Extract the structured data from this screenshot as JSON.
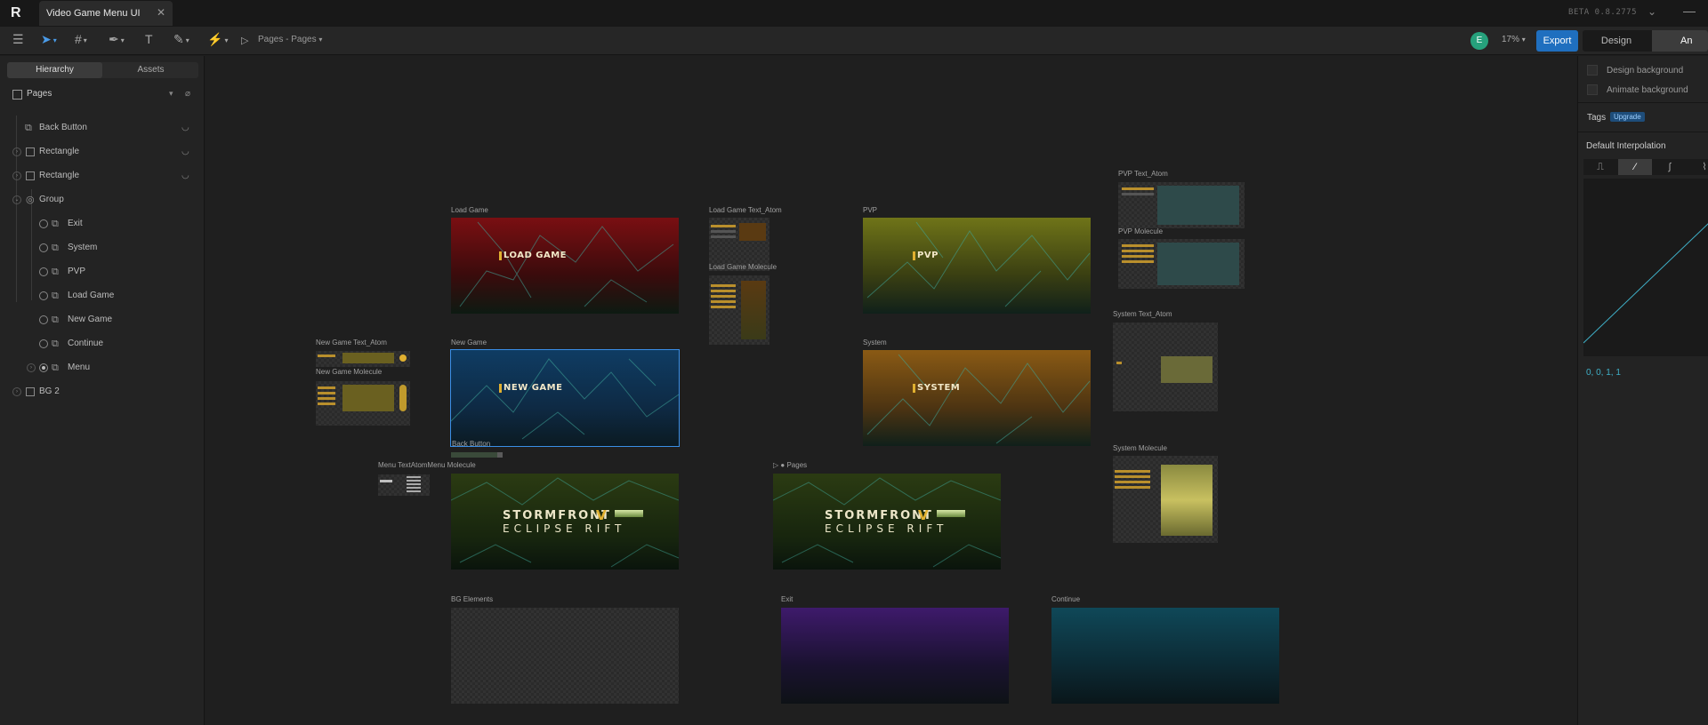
{
  "titlebar": {
    "doc_title": "Video Game Menu UI",
    "close_glyph": "✕",
    "version": "BETA 0.8.2775",
    "chevron": "⌄",
    "minimize_glyph": "—",
    "logo_glyph": "R"
  },
  "toolbar": {
    "breadcrumb": "Pages - Pages",
    "avatar_initial": "E",
    "zoom": "17%",
    "export_label": "Export",
    "mode_design": "Design",
    "mode_animate": "An",
    "icons": [
      "menu-icon",
      "pointer-icon",
      "frame-icon",
      "pen-icon",
      "text-icon",
      "brush-icon",
      "lightning-icon",
      "play-icon"
    ]
  },
  "left_panel": {
    "tab_hierarchy": "Hierarchy",
    "tab_assets": "Assets",
    "pages_label": "Pages",
    "layers": [
      {
        "name": "Back Button",
        "icon": "component-icon"
      },
      {
        "name": "Rectangle",
        "icon": "rectangle-icon"
      },
      {
        "name": "Rectangle",
        "icon": "rectangle-icon"
      },
      {
        "name": "Group",
        "icon": "group-icon"
      },
      {
        "name": "Exit",
        "icon": "component-icon"
      },
      {
        "name": "System",
        "icon": "component-icon"
      },
      {
        "name": "PVP",
        "icon": "component-icon"
      },
      {
        "name": "Load Game",
        "icon": "component-icon"
      },
      {
        "name": "New Game",
        "icon": "component-icon"
      },
      {
        "name": "Continue",
        "icon": "component-icon"
      },
      {
        "name": "Menu",
        "icon": "component-icon"
      },
      {
        "name": "BG 2",
        "icon": "rectangle-icon"
      }
    ]
  },
  "canvas": {
    "frames": {
      "load_game": {
        "label": "Load Game",
        "text": "LOAD GAME"
      },
      "load_game_text_atom": {
        "label": "Load Game Text_Atom"
      },
      "load_game_molecule": {
        "label": "Load Game Molecule"
      },
      "pvp": {
        "label": "PVP",
        "text": "PVP"
      },
      "pvp_text_atom": {
        "label": "PVP Text_Atom"
      },
      "pvp_molecule": {
        "label": "PVP Molecule"
      },
      "new_game_text_atom": {
        "label": "New Game Text_Atom"
      },
      "new_game_molecule": {
        "label": "New Game Molecule"
      },
      "new_game": {
        "label": "New Game",
        "text": "NEW GAME"
      },
      "system": {
        "label": "System",
        "text": "SYSTEM"
      },
      "system_text_atom": {
        "label": "System Text_Atom"
      },
      "system_molecule": {
        "label": "System Molecule"
      },
      "back_button": {
        "label": "Back Button"
      },
      "menu_overlap": {
        "label": "Menu TextAtomMenu Molecule"
      },
      "menu": {
        "title_line1": "STORMFRONT",
        "title_v": "V",
        "title_line2": "ECLIPSE  RIFT"
      },
      "pages": {
        "label": "Pages",
        "title_line1": "STORMFRONT",
        "title_v": "V",
        "title_line2": "ECLIPSE  RIFT"
      },
      "bg_elements": {
        "label": "BG Elements"
      },
      "exit": {
        "label": "Exit"
      },
      "continue": {
        "label": "Continue"
      }
    },
    "colors": {
      "load_game_top": "#7a0f12",
      "pvp_top": "#6f7418",
      "new_game_top": "#0f3c63",
      "system_top": "#8a5a14",
      "menu_top": "#2b3b12",
      "exit_top": "#3e1a6b",
      "continue_top": "#0f4858",
      "selection": "#3a8ee6"
    }
  },
  "right_panel": {
    "design_background": "Design background",
    "animate_background": "Animate background",
    "tags": "Tags",
    "upgrade": "Upgrade",
    "default_interpolation": "Default Interpolation",
    "interp_icons": [
      "step-icon",
      "linear-icon",
      "ease-icon",
      "ease-in-out-icon"
    ],
    "curve_values": "0, 0, 1, 1"
  }
}
